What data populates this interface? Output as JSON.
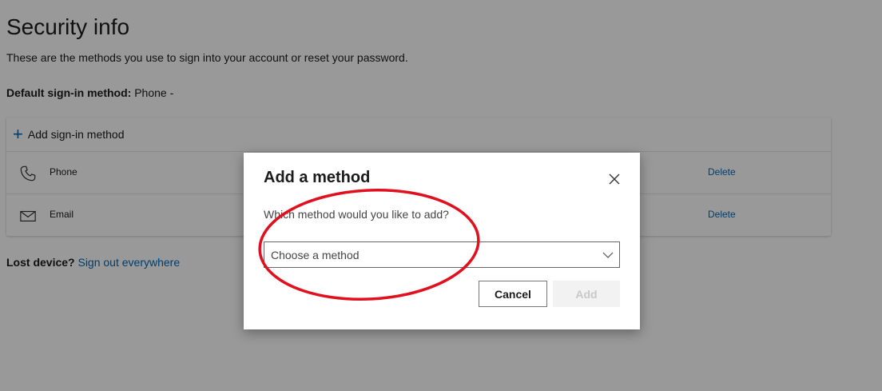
{
  "page": {
    "title": "Security info",
    "subtitle": "These are the methods you use to sign into your account or reset your password.",
    "default_method_label": "Default sign-in method:",
    "default_method_value": "Phone -",
    "add_method_label": "Add sign-in method",
    "methods": [
      {
        "icon": "phone-icon",
        "label": "Phone",
        "delete_label": "Delete"
      },
      {
        "icon": "email-icon",
        "label": "Email",
        "delete_label": "Delete"
      }
    ],
    "lost_device_label": "Lost device?",
    "sign_out_link": "Sign out everywhere"
  },
  "dialog": {
    "title": "Add a method",
    "question": "Which method would you like to add?",
    "select_value": "Choose a method",
    "cancel_label": "Cancel",
    "add_label": "Add"
  },
  "colors": {
    "accent": "#0067b8",
    "annotation": "#e0101e"
  }
}
